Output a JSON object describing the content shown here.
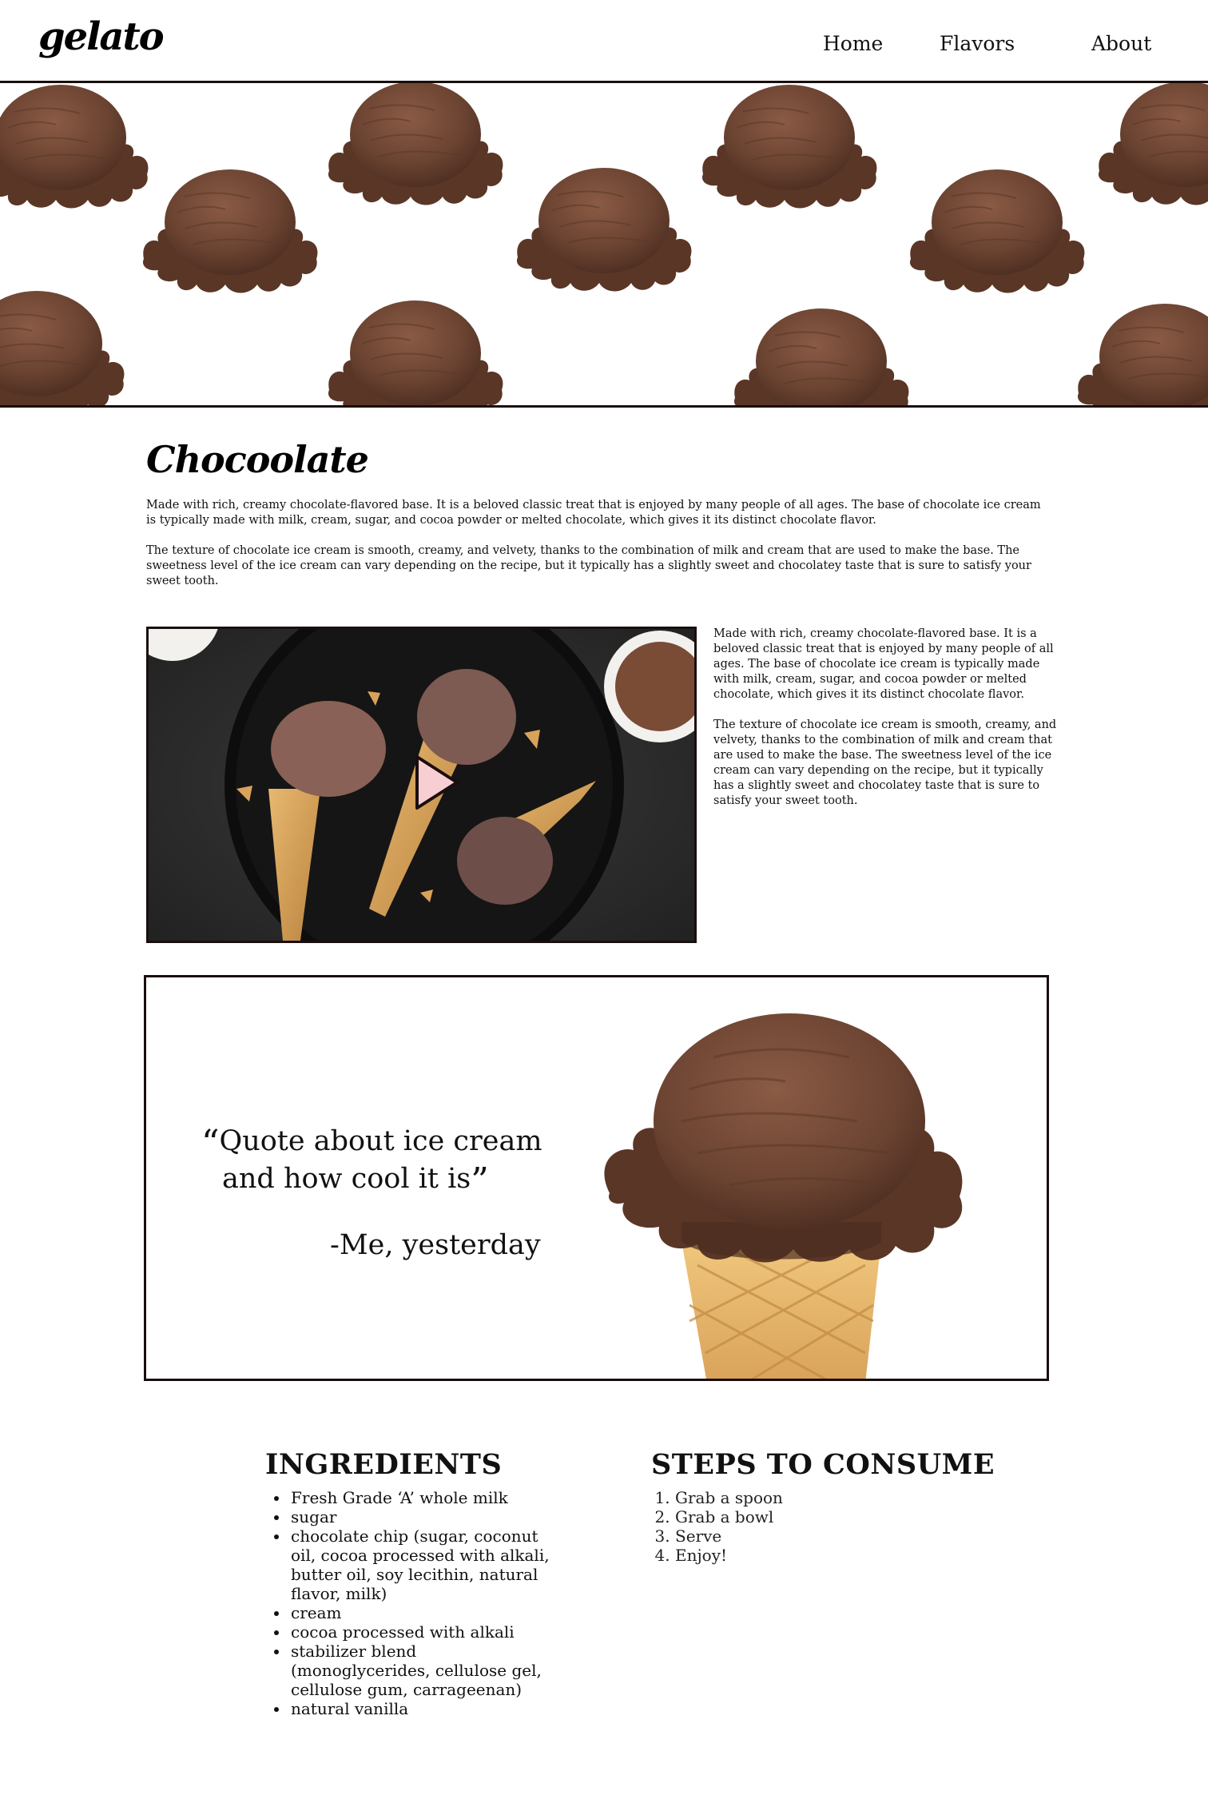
{
  "header": {
    "logo": "gelato",
    "nav": {
      "home": "Home",
      "flavors": "Flavors",
      "about": "About"
    }
  },
  "flavor": {
    "title": "Chocoolate",
    "intro": [
      "Made with rich, creamy chocolate-flavored base. It is a beloved classic treat that is enjoyed by many people of all ages. The base of chocolate ice cream is typically made with milk, cream, sugar, and cocoa powder or melted chocolate, which gives it its distinct chocolate flavor.",
      "The texture of chocolate ice cream is smooth, creamy, and velvety, thanks to the combination of milk and cream that are used to make the base. The sweetness level of the ice cream can vary depending on the recipe, but it typically has a slightly sweet and chocolatey taste that is sure to satisfy your sweet tooth."
    ],
    "side": [
      "Made with rich, creamy chocolate-flavored base. It is a beloved classic treat that is enjoyed by many people of all ages. The base of chocolate ice cream is typically made with milk, cream, sugar, and cocoa powder or melted chocolate, which gives it its distinct chocolate flavor.",
      "The texture of chocolate ice cream is smooth, creamy, and velvety, thanks to the combination of milk and cream that are used to make the base. The sweetness level of the ice cream can vary depending on the recipe, but it typically has a slightly sweet and chocolatey taste that is sure to satisfy your sweet tooth."
    ]
  },
  "quote": {
    "text_line1": "Quote about ice cream",
    "text_line2": "and how cool it is",
    "open_mark": "“",
    "close_mark": "”",
    "author": "-Me, yesterday"
  },
  "ingredients": {
    "title": "INGREDIENTS",
    "items": [
      "Fresh Grade ‘A’ whole milk",
      "sugar",
      "chocolate chip (sugar, coconut oil, cocoa processed with alkali, butter oil, soy lecithin, natural flavor, milk)",
      "cream",
      "cocoa processed with alkali",
      "stabilizer blend (monoglycerides, cellulose gel, cellulose gum, carrageenan)",
      "natural vanilla"
    ]
  },
  "steps": {
    "title": "STEPS TO CONSUME",
    "items": [
      "Grab a spoon",
      "Grab a bowl",
      "Serve",
      "Enjoy!"
    ]
  },
  "colors": {
    "chocolate": "#6b4331",
    "chocolate_dark": "#4a2c20",
    "border": "#1a0e0e",
    "play_fill": "#f7cfd2",
    "cone": "#d9a25a"
  },
  "icons": {
    "play": "play-icon",
    "quote_open": "quote-open-icon",
    "quote_close": "quote-close-icon"
  }
}
